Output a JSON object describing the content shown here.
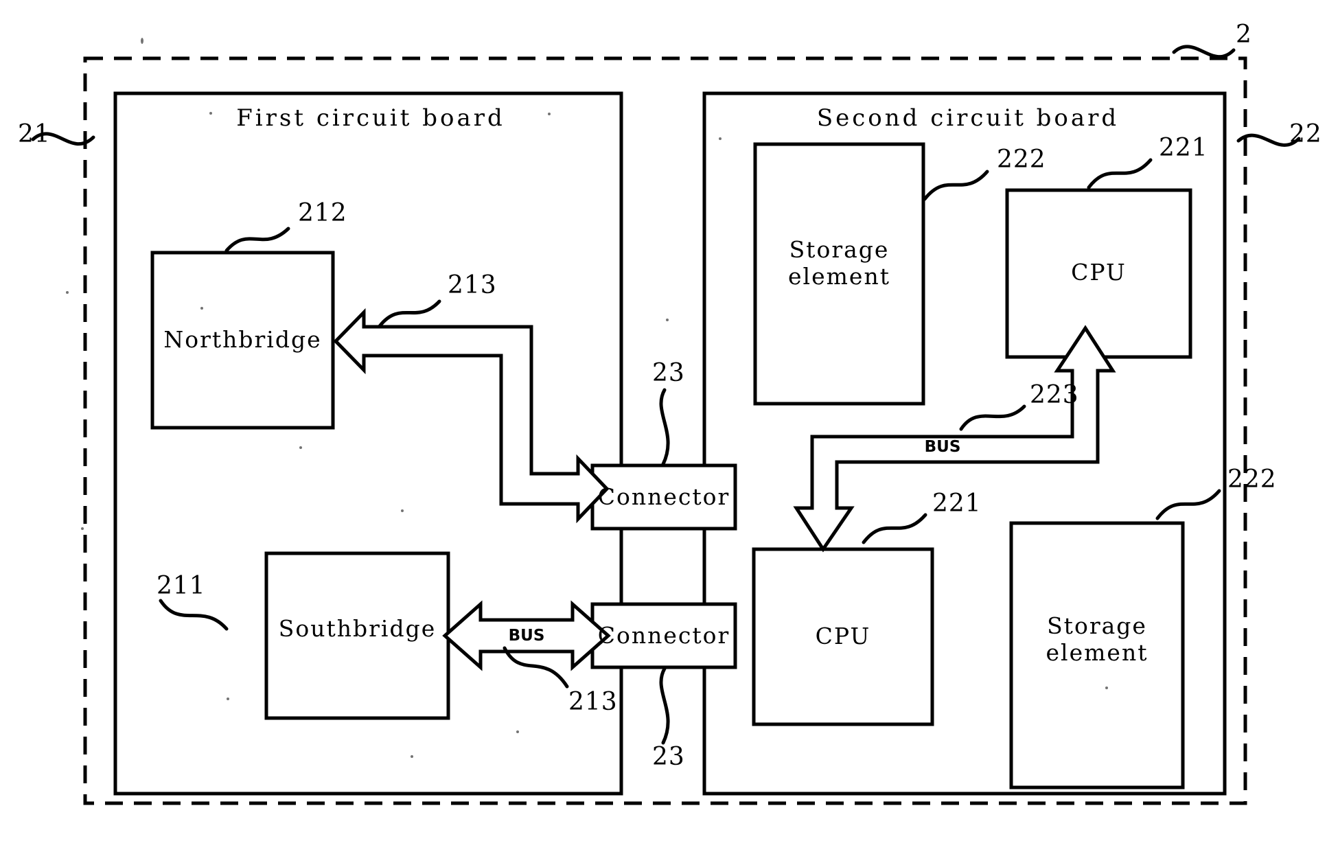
{
  "figure": {
    "type": "patent-block-diagram",
    "outer_ref": "2",
    "boards": {
      "first": {
        "title": "First circuit board",
        "ref": "21",
        "blocks": [
          {
            "id": "northbridge",
            "label": "Northbridge",
            "ref": "212"
          },
          {
            "id": "southbridge",
            "label": "Southbridge",
            "ref": "211"
          }
        ],
        "buses": [
          {
            "id": "bus-northbridge",
            "label": "",
            "ref": "213",
            "direction": "northbridge-and-connector"
          },
          {
            "id": "bus-southbridge",
            "label": "BUS",
            "ref": "213",
            "direction": "bidirectional"
          }
        ]
      },
      "second": {
        "title": "Second circuit board",
        "ref": "22",
        "blocks": [
          {
            "id": "storage-top",
            "label": "Storage\nelement",
            "ref": "222"
          },
          {
            "id": "cpu-top",
            "label": "CPU",
            "ref": "221"
          },
          {
            "id": "cpu-bottom",
            "label": "CPU",
            "ref": "221"
          },
          {
            "id": "storage-bottom",
            "label": "Storage\nelement",
            "ref": "222"
          }
        ],
        "buses": [
          {
            "id": "bus-cpu",
            "label": "BUS",
            "ref": "223",
            "direction": "bidirectional"
          }
        ]
      }
    },
    "connectors": [
      {
        "id": "connector-top",
        "label": "Connector",
        "ref": "23"
      },
      {
        "id": "connector-bottom",
        "label": "Connector",
        "ref": "23"
      }
    ],
    "reference_numerals": {
      "outer_system": "2",
      "first_board": "21",
      "second_board": "22",
      "southbridge": "211",
      "northbridge": "212",
      "first_board_bus_top": "213",
      "first_board_bus_bottom": "213",
      "connector_top": "23",
      "connector_bottom": "23",
      "cpu_top": "221",
      "cpu_bottom": "221",
      "storage_top": "222",
      "storage_bottom": "222",
      "second_board_bus": "223"
    },
    "colors": {
      "ink": "#000000",
      "paper": "#ffffff"
    }
  }
}
